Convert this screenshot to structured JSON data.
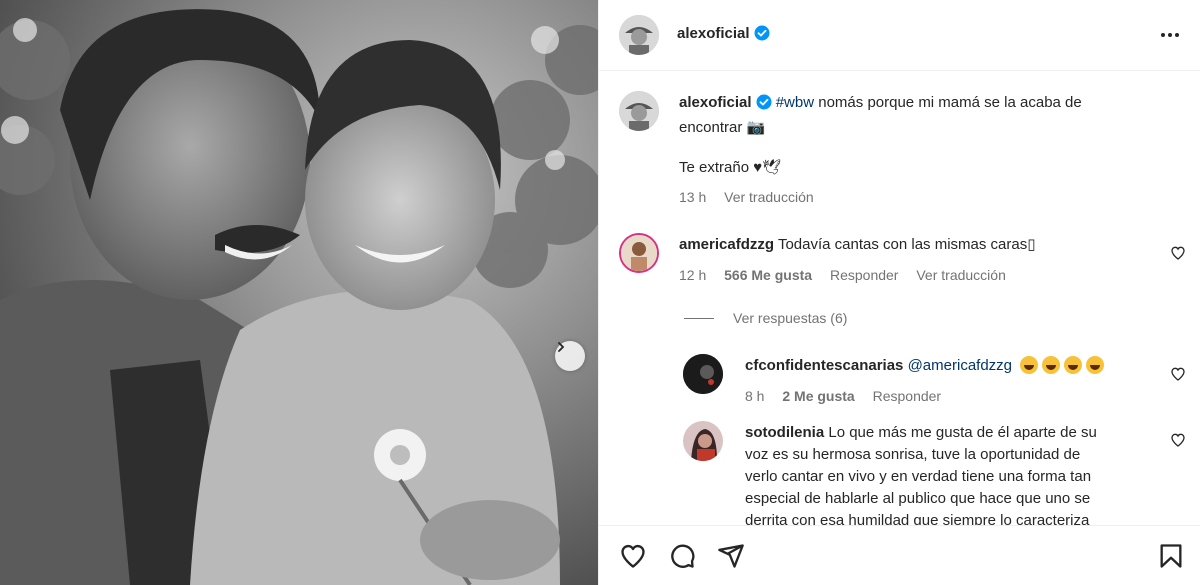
{
  "post": {
    "author": "alexoficial",
    "caption_hashtag": "#wbw",
    "caption_line1": "nomás porque mi mamá se la acaba de",
    "caption_line2": "encontrar 📷",
    "caption_line3": "Te extraño ♥🕊",
    "time": "13 h",
    "translate": "Ver traducción"
  },
  "comments": [
    {
      "user": "americafdzzg",
      "text": "Todavía cantas con las mismas caras▯",
      "time": "12 h",
      "likes": "566 Me gusta",
      "reply": "Responder",
      "translate": "Ver traducción"
    }
  ],
  "view_replies": "Ver respuestas (6)",
  "replies": [
    {
      "user": "cfconfidentescanarias",
      "mention": "@americafdzzg",
      "time": "8 h",
      "likes": "2 Me gusta",
      "reply": "Responder"
    },
    {
      "user": "sotodilenia",
      "text_lines": [
        "Lo que más me gusta de él aparte de su",
        "voz es su hermosa sonrisa, tuve la oportunidad de",
        "verlo cantar en vivo y en verdad tiene una forma tan",
        "especial de hablarle al publico que hace que uno se",
        "derrita con esa humildad que siempre lo caracteriza"
      ]
    }
  ],
  "colors": {
    "verified": "#0095f6",
    "hashtag": "#00376b",
    "secondary_text": "#737373",
    "border": "#efefef"
  },
  "icons": [
    "verified-badge-icon",
    "more-options-icon",
    "heart-icon",
    "comment-icon",
    "share-icon",
    "bookmark-icon",
    "chevron-right-icon"
  ]
}
